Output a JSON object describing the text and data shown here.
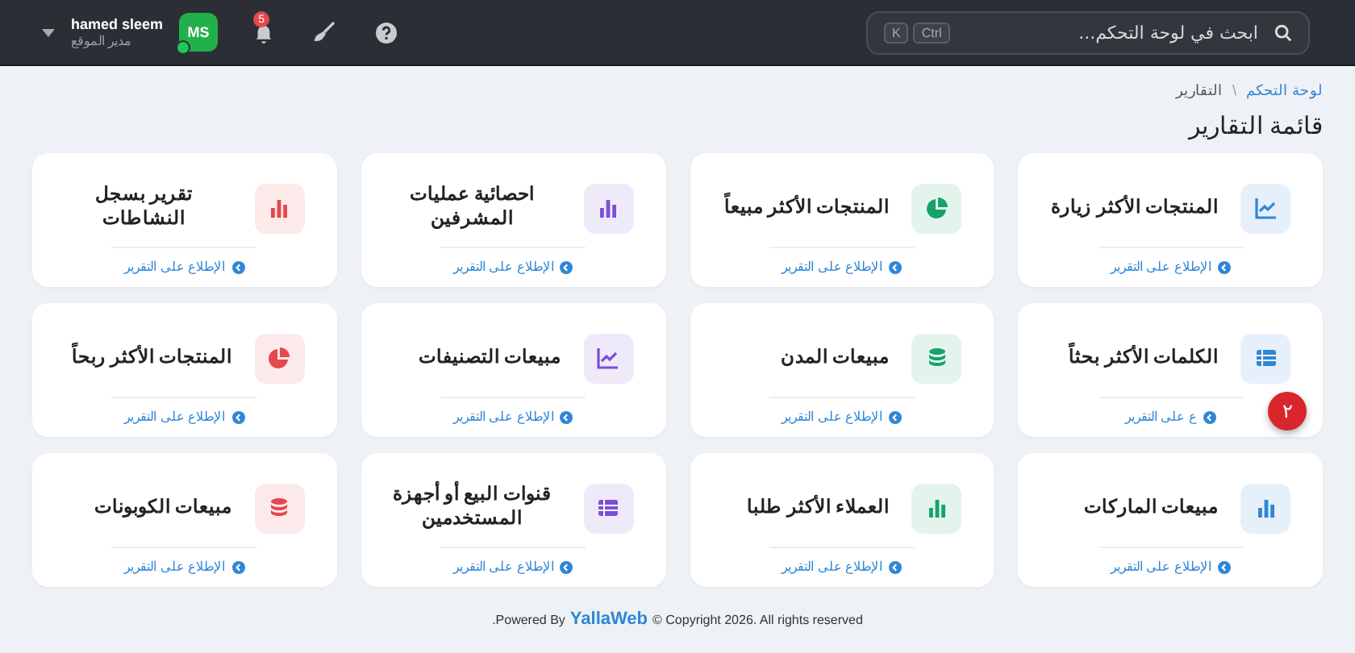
{
  "topbar": {
    "search": {
      "placeholder": "ابحث في لوحة التحكم...",
      "shortcut": [
        "Ctrl",
        "K"
      ]
    },
    "notifications": {
      "count": "5"
    },
    "user": {
      "name": "hamed sleem",
      "role": "مدير الموقع",
      "initials": "MS",
      "online": true
    }
  },
  "breadcrumb": [
    {
      "label": "لوحة التحكم",
      "kind": "link"
    },
    {
      "label": "\\",
      "kind": "separator"
    },
    {
      "label": "التقارير",
      "kind": "current"
    }
  ],
  "title": "قائمة التقارير",
  "cards": [
    {
      "title": "المنتجات الأكثر زيارة",
      "kind": "line",
      "color": "#2f86d6",
      "link": "الإطلاع على التقرير"
    },
    {
      "title": "المنتجات الأكثر مبيعاً",
      "kind": "pie",
      "color": "#16a36a",
      "link": "الإطلاع على التقرير"
    },
    {
      "title": "احصائية عمليات المشرفين",
      "kind": "bars",
      "color": "#7c4fd6",
      "link": "الإطلاع على التقرير"
    },
    {
      "title": "تقرير بسجل النشاطات",
      "kind": "bars",
      "color": "#e5484d",
      "link": "الإطلاع على التقرير"
    },
    {
      "title": "الكلمات الأكثر بحثاً",
      "kind": "table",
      "color": "#2f86d6",
      "link": "ع على التقرير",
      "step": "٢"
    },
    {
      "title": "مبيعات المدن",
      "kind": "coins",
      "color": "#16a36a",
      "link": "الإطلاع على التقرير"
    },
    {
      "title": "مبيعات التصنيفات",
      "kind": "line",
      "color": "#7c4fd6",
      "link": "الإطلاع على التقرير"
    },
    {
      "title": "المنتجات الأكثر ربحاً",
      "kind": "pie",
      "color": "#e5484d",
      "link": "الإطلاع على التقرير"
    },
    {
      "title": "مبيعات الماركات",
      "kind": "bars",
      "color": "#2f86d6",
      "link": "الإطلاع على التقرير"
    },
    {
      "title": "العملاء الأكثر طلبا",
      "kind": "bars",
      "color": "#16a36a",
      "link": "الإطلاع على التقرير"
    },
    {
      "title": "قنوات البيع أو أجهزة المستخدمين",
      "kind": "table",
      "color": "#7c4fd6",
      "link": "الإطلاع على التقرير"
    },
    {
      "title": "مبيعات الكوبونات",
      "kind": "coins",
      "color": "#e5484d",
      "link": "الإطلاع على التقرير"
    }
  ],
  "footer": {
    "before": ".Powered By",
    "brand": "YallaWeb",
    "after": "© Copyright 2026. All rights reserved"
  }
}
